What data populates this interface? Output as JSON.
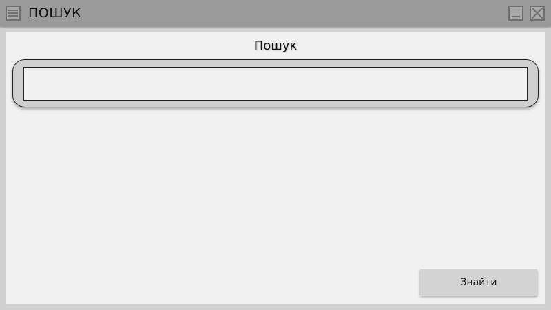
{
  "window": {
    "title": "ПОШУК",
    "icons": {
      "menu": "hamburger-menu-icon",
      "minimize": "minimize-icon",
      "close": "close-icon"
    }
  },
  "main": {
    "heading": "Пошук",
    "search": {
      "value": "",
      "placeholder": ""
    },
    "find_button_label": "Знайти"
  },
  "colors": {
    "titlebar": "#9b9b9b",
    "window_background": "#d0d0d0",
    "content_background": "#f1f1f1",
    "button_background": "#d3d3d3"
  }
}
